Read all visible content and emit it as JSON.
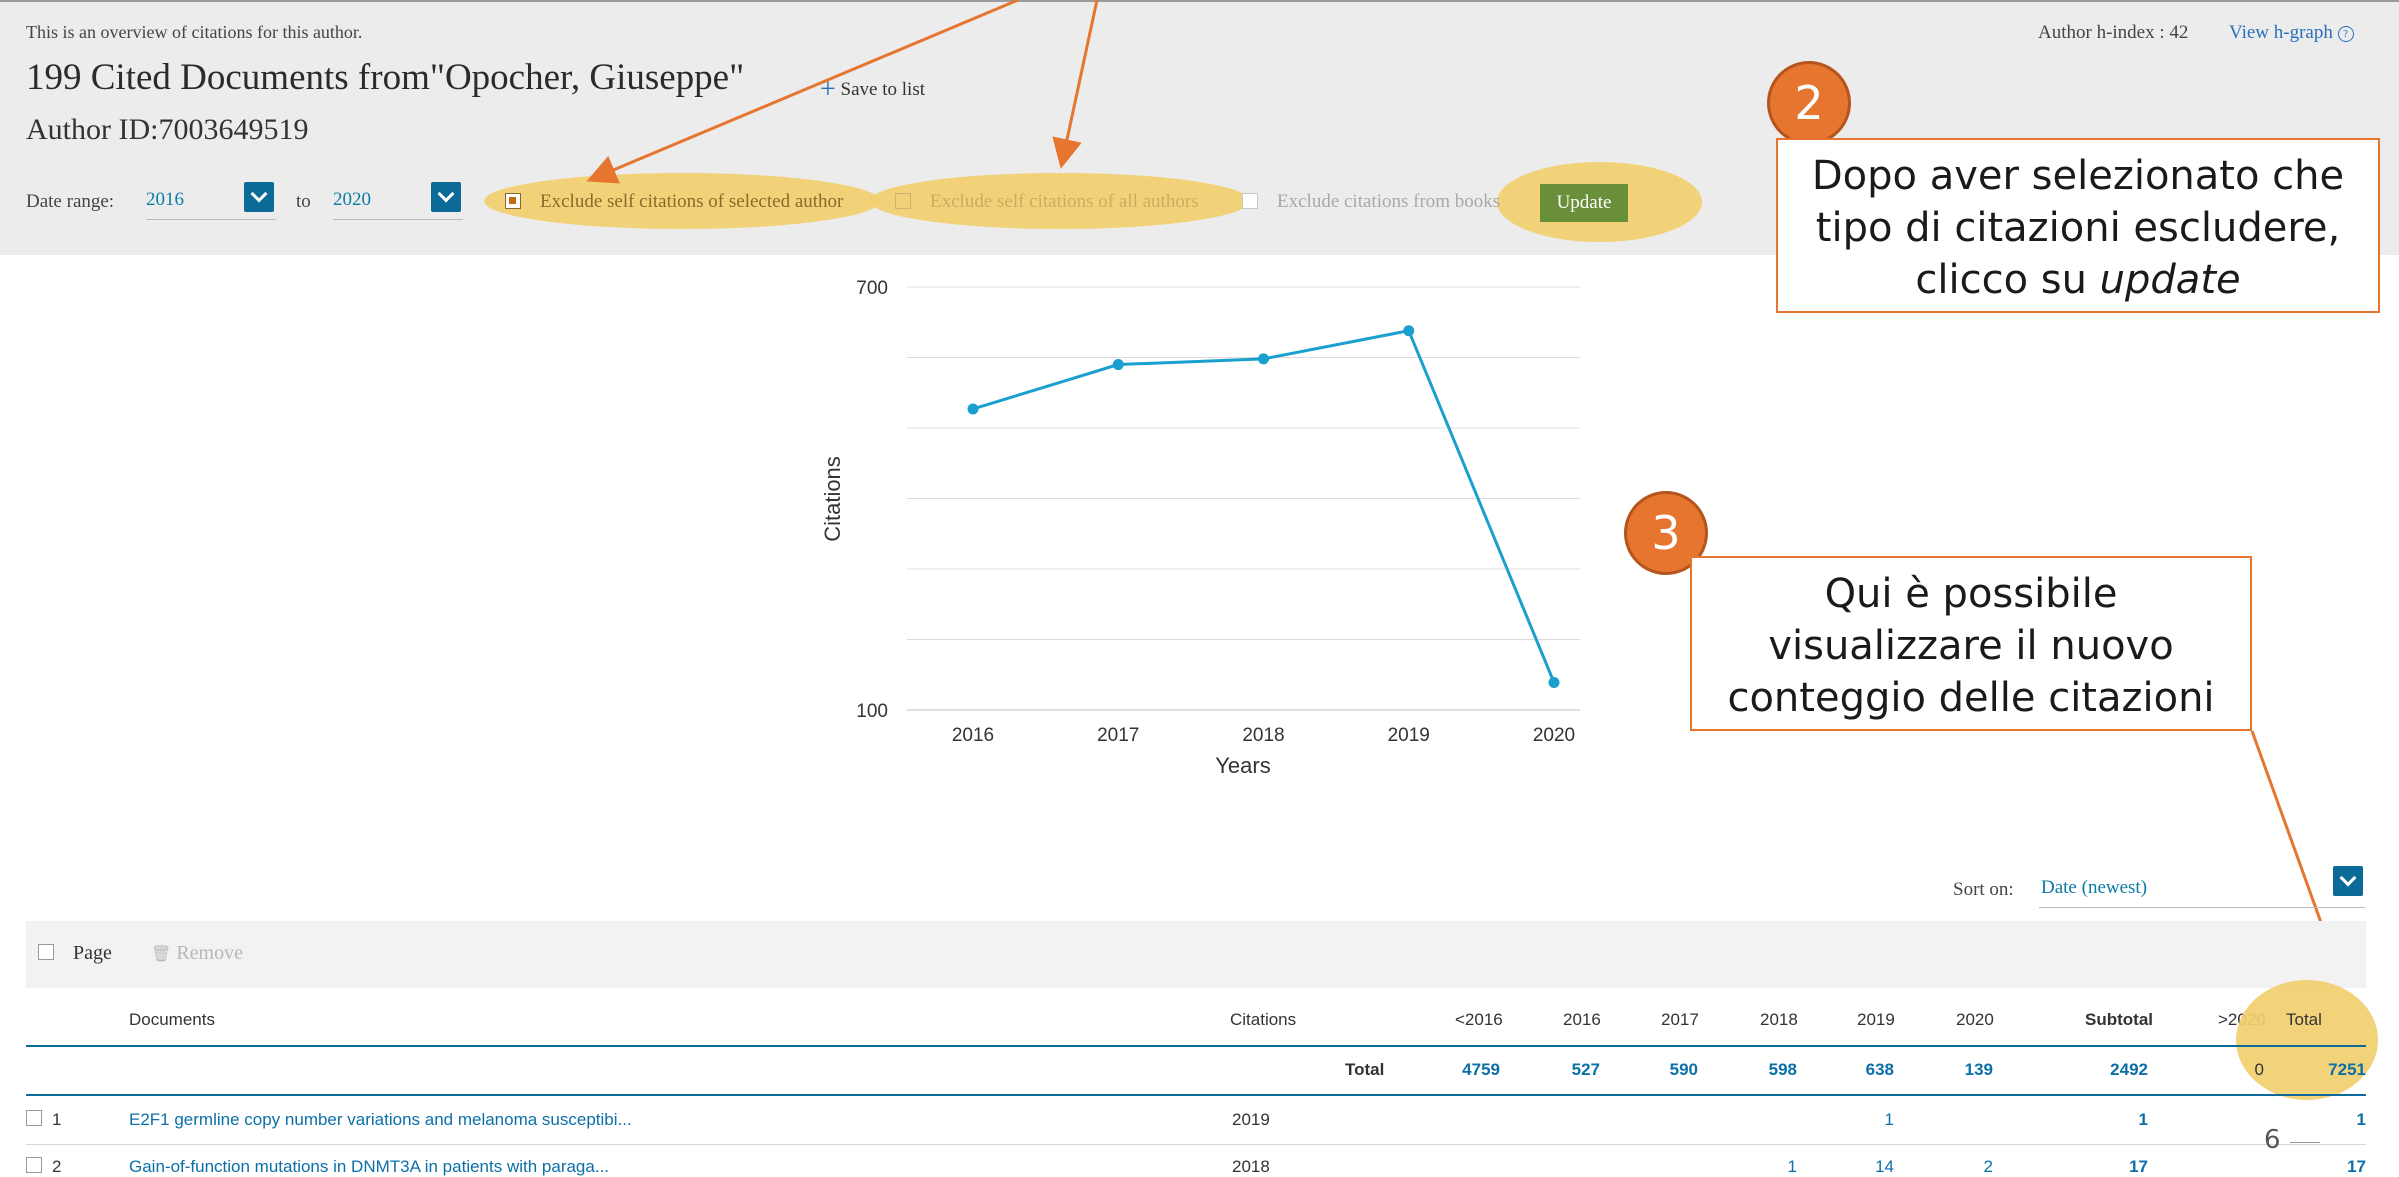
{
  "header": {
    "overview_text": "This is an overview of citations for this author.",
    "title": "199 Cited Documents from\"Opocher, Giuseppe\"",
    "save_to_list": "Save to list",
    "author_id": "Author ID:7003649519",
    "h_index_label": "Author h-index : 42",
    "view_h_graph": "View h-graph"
  },
  "filters": {
    "date_range_label": "Date range:",
    "from_year": "2016",
    "to_label": "to",
    "to_year": "2020",
    "exclude_selected": "Exclude self citations of selected author",
    "exclude_all": "Exclude self citations of all authors",
    "exclude_books": "Exclude citations from books",
    "update_label": "Update"
  },
  "chart_data": {
    "type": "line",
    "x": [
      2016,
      2017,
      2018,
      2019,
      2020
    ],
    "values": [
      527,
      590,
      598,
      638,
      139
    ],
    "xlabel": "Years",
    "ylabel": "Citations",
    "ylim": [
      100,
      700
    ],
    "y_ticks": [
      "700",
      "100"
    ],
    "x_ticks": [
      "2016",
      "2017",
      "2018",
      "2019",
      "2020"
    ],
    "grid": true,
    "color": "#1aa0cf"
  },
  "callouts": {
    "two": {
      "number": "2",
      "text": [
        "Dopo aver selezionato che",
        "tipo di citazioni escludere,",
        "clicco su "
      ],
      "italic": "update"
    },
    "three": {
      "number": "3",
      "text": [
        "Qui è possibile",
        "visualizzare il nuovo",
        "conteggio delle citazioni"
      ]
    }
  },
  "sort": {
    "label": "Sort on:",
    "value": "Date (newest)"
  },
  "toolbar": {
    "page_label": "Page",
    "remove_label": "Remove"
  },
  "table": {
    "headers": [
      "Documents",
      "Citations",
      "<2016",
      "2016",
      "2017",
      "2018",
      "2019",
      "2020",
      "Subtotal",
      ">2020",
      "Total"
    ],
    "total_row": {
      "label": "Total",
      "values": [
        "4759",
        "527",
        "590",
        "598",
        "638",
        "139",
        "2492",
        "0",
        "7251"
      ]
    },
    "rows": [
      {
        "index": "1",
        "title": "E2F1 germline copy number variations and melanoma susceptibi...",
        "year": "2019",
        "c2019": "1",
        "subtotal": "1",
        "total": "1"
      },
      {
        "index": "2",
        "title": "Gain-of-function mutations in DNMT3A in patients with paraga...",
        "year": "2018",
        "c2018": "1",
        "c2019": "14",
        "c2020": "2",
        "subtotal": "17",
        "total": "17"
      }
    ]
  },
  "slide_number": "6",
  "colors": {
    "accent": "#e5752f",
    "highlight": "#f2cf6e",
    "link": "#0d6fa8",
    "update_button": "#6a8f3a"
  }
}
